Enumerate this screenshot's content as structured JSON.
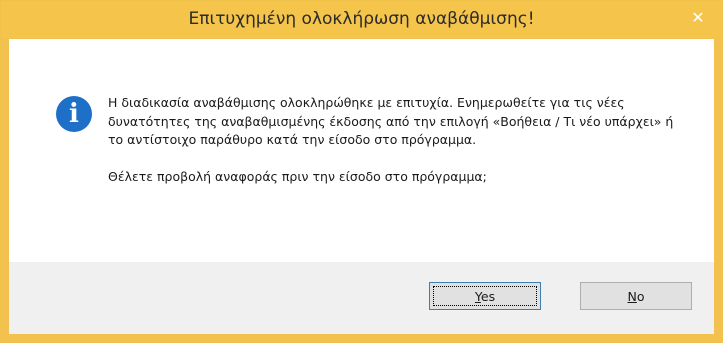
{
  "window": {
    "title": "Επιτυχημένη ολοκλήρωση αναβάθμισης!",
    "close_glyph": "✕"
  },
  "icon": {
    "name": "info-icon",
    "glyph": "i",
    "color": "#1e6fc8"
  },
  "message": {
    "body": "Η διαδικασία αναβάθμισης ολοκληρώθηκε με επιτυχία. Ενημερωθείτε για τις νέες δυνατότητες της αναβαθμισμένης έκδοσης από την επιλογή «Βοήθεια / Τι νέο υπάρχει» ή το αντίστοιχο παράθυρο κατά την είσοδο στο πρόγραμμα.",
    "question": "Θέλετε προβολή αναφοράς πριν την είσοδο στο πρόγραμμα;"
  },
  "buttons": {
    "yes": {
      "mnemonic": "Y",
      "rest": "es"
    },
    "no": {
      "mnemonic": "N",
      "rest": "o"
    }
  },
  "colors": {
    "titlebar": "#f4c44b",
    "accent": "#1e6fc8"
  }
}
